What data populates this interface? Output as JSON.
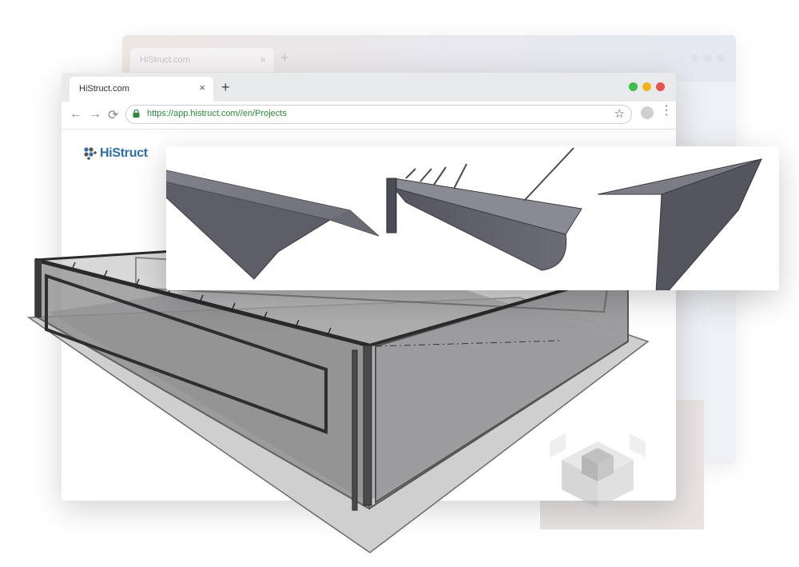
{
  "background_window": {
    "tab_title": "HiStruct.com",
    "tab_close_glyph": "×",
    "new_tab_glyph": "+"
  },
  "main_window": {
    "tab_title": "HiStruct.com",
    "tab_close_glyph": "×",
    "new_tab_glyph": "+",
    "window_controls": [
      {
        "name": "minimize",
        "color": "#3bbf4a"
      },
      {
        "name": "maximize",
        "color": "#f2b31c"
      },
      {
        "name": "close",
        "color": "#e5534b"
      }
    ],
    "toolbar": {
      "back_glyph": "←",
      "forward_glyph": "→",
      "reload_glyph": "⟳",
      "url": "https://app.histruct.com//en/Projects",
      "bookmark_glyph": "☆",
      "menu_glyph": "⋮"
    },
    "logo": {
      "text": "HiStruct",
      "brand_color": "#2c6fad"
    }
  },
  "product_card": {
    "items": [
      {
        "icon": "ridge-flashing-icon"
      },
      {
        "icon": "gutter-with-downpipe-icon"
      },
      {
        "icon": "corner-flashing-icon"
      }
    ]
  },
  "colors": {
    "metal": "#5c5c66",
    "accent": "#2c6fad"
  }
}
